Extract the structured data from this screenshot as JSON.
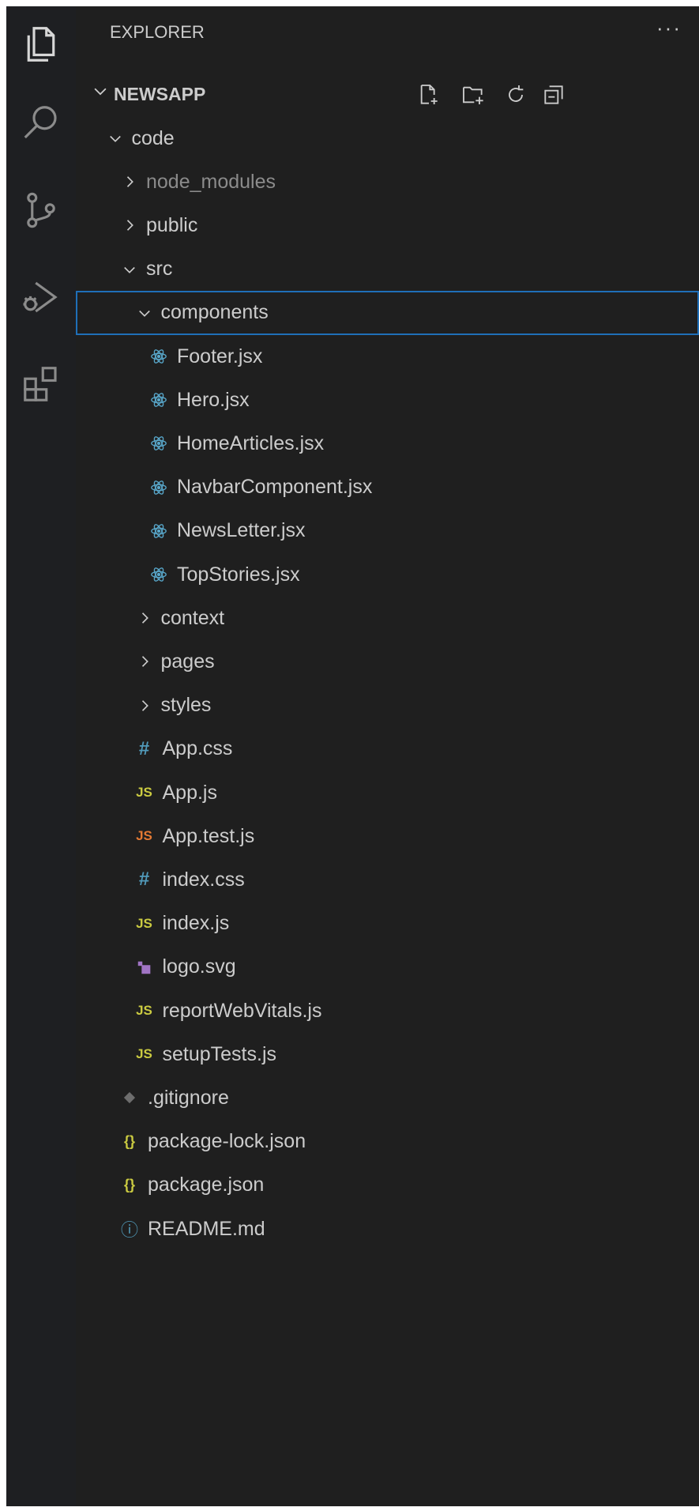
{
  "colors": {
    "background": "#1f1f1f",
    "text": "#cccccc",
    "dimmed_text": "#8b8b8b",
    "selection_border": "#1f6fb8",
    "react_icon": "#58a6c9",
    "css_icon": "#519aba",
    "js_icon": "#cbcb41",
    "js_test_icon": "#e37933",
    "svg_icon": "#a074c4",
    "json_icon": "#cbcb41",
    "readme_icon": "#519aba",
    "gitignore_icon": "#6d6d6d"
  },
  "activity_bar": {
    "items": [
      "files-icon",
      "search-icon",
      "source-control-icon",
      "run-debug-icon",
      "extensions-icon"
    ]
  },
  "explorer": {
    "title": "EXPLORER",
    "more_actions": "···",
    "section_title": "NEWSAPP",
    "header_actions": [
      "new-file-icon",
      "new-folder-icon",
      "refresh-icon",
      "collapse-all-icon"
    ]
  },
  "tree": [
    {
      "label": "code",
      "type": "folder",
      "expanded": true,
      "depth": 1
    },
    {
      "label": "node_modules",
      "type": "folder",
      "expanded": false,
      "depth": 2,
      "dim": true
    },
    {
      "label": "public",
      "type": "folder",
      "expanded": false,
      "depth": 2
    },
    {
      "label": "src",
      "type": "folder",
      "expanded": true,
      "depth": 2
    },
    {
      "label": "components",
      "type": "folder",
      "expanded": true,
      "depth": 3,
      "selected": true
    },
    {
      "label": "Footer.jsx",
      "type": "react",
      "depth": 4
    },
    {
      "label": "Hero.jsx",
      "type": "react",
      "depth": 4
    },
    {
      "label": "HomeArticles.jsx",
      "type": "react",
      "depth": 4
    },
    {
      "label": "NavbarComponent.jsx",
      "type": "react",
      "depth": 4
    },
    {
      "label": "NewsLetter.jsx",
      "type": "react",
      "depth": 4
    },
    {
      "label": "TopStories.jsx",
      "type": "react",
      "depth": 4
    },
    {
      "label": "context",
      "type": "folder",
      "expanded": false,
      "depth": 3
    },
    {
      "label": "pages",
      "type": "folder",
      "expanded": false,
      "depth": 3
    },
    {
      "label": "styles",
      "type": "folder",
      "expanded": false,
      "depth": 3
    },
    {
      "label": "App.css",
      "type": "css",
      "depth": 3
    },
    {
      "label": "App.js",
      "type": "js",
      "depth": 3
    },
    {
      "label": "App.test.js",
      "type": "jstest",
      "depth": 3
    },
    {
      "label": "index.css",
      "type": "css",
      "depth": 3
    },
    {
      "label": "index.js",
      "type": "js",
      "depth": 3
    },
    {
      "label": "logo.svg",
      "type": "svg",
      "depth": 3
    },
    {
      "label": "reportWebVitals.js",
      "type": "js",
      "depth": 3
    },
    {
      "label": "setupTests.js",
      "type": "js",
      "depth": 3
    },
    {
      "label": ".gitignore",
      "type": "gitignore",
      "depth": 2
    },
    {
      "label": "package-lock.json",
      "type": "json",
      "depth": 2
    },
    {
      "label": "package.json",
      "type": "json",
      "depth": 2
    },
    {
      "label": "README.md",
      "type": "readme",
      "depth": 2
    }
  ],
  "glyphs": {
    "css": "#",
    "js": "JS",
    "json": "{}",
    "readme": "ⓘ"
  }
}
